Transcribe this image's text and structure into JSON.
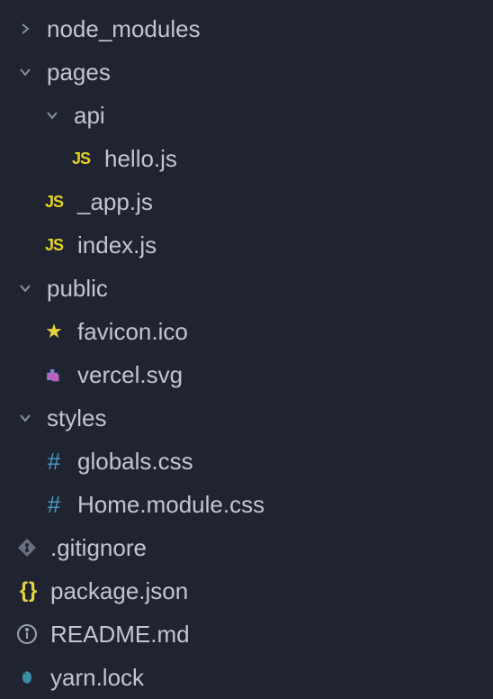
{
  "tree": {
    "node_modules": "node_modules",
    "pages": "pages",
    "api": "api",
    "hello_js": "hello.js",
    "app_js": "_app.js",
    "index_js": "index.js",
    "public": "public",
    "favicon": "favicon.ico",
    "vercel": "vercel.svg",
    "styles": "styles",
    "globals": "globals.css",
    "home_module": "Home.module.css",
    "gitignore": ".gitignore",
    "package_json": "package.json",
    "readme": "README.md",
    "yarn_lock": "yarn.lock"
  }
}
